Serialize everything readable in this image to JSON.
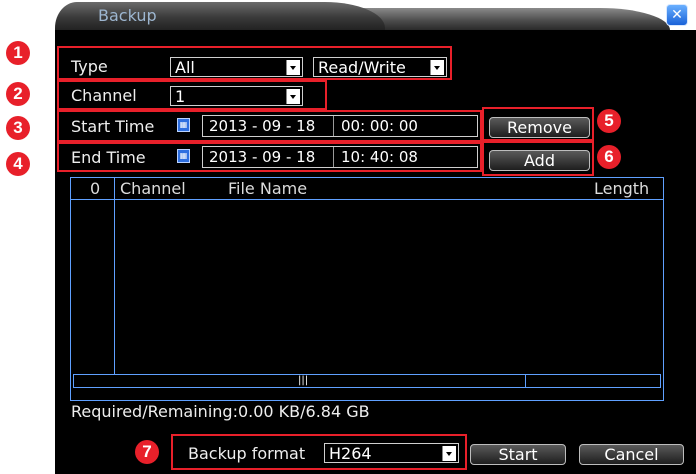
{
  "window": {
    "title": "Backup",
    "close_icon": "close-icon"
  },
  "form": {
    "type_label": "Type",
    "type_value": "All",
    "mode_value": "Read/Write",
    "channel_label": "Channel",
    "channel_value": "1",
    "start_label": "Start Time",
    "start_date": "2013 - 09 - 18",
    "start_time": "00: 00: 00",
    "end_label": "End Time",
    "end_date": "2013 - 09 - 18",
    "end_time": "10: 40: 08",
    "remove_label": "Remove",
    "add_label": "Add",
    "calendar_icon": "calendar-icon"
  },
  "table": {
    "columns": [
      "0",
      "Channel",
      "File Name",
      "Length"
    ],
    "rows": []
  },
  "status": {
    "required_remaining": "Required/Remaining:0.00 KB/6.84 GB"
  },
  "footer": {
    "format_label": "Backup format",
    "format_value": "H264",
    "start_label": "Start",
    "cancel_label": "Cancel"
  },
  "callouts": [
    "1",
    "2",
    "3",
    "4",
    "5",
    "6",
    "7"
  ],
  "colors": {
    "callout_red": "#e8202a",
    "grid_blue": "#5fa0ff",
    "close_blue": "#2a78e8"
  }
}
